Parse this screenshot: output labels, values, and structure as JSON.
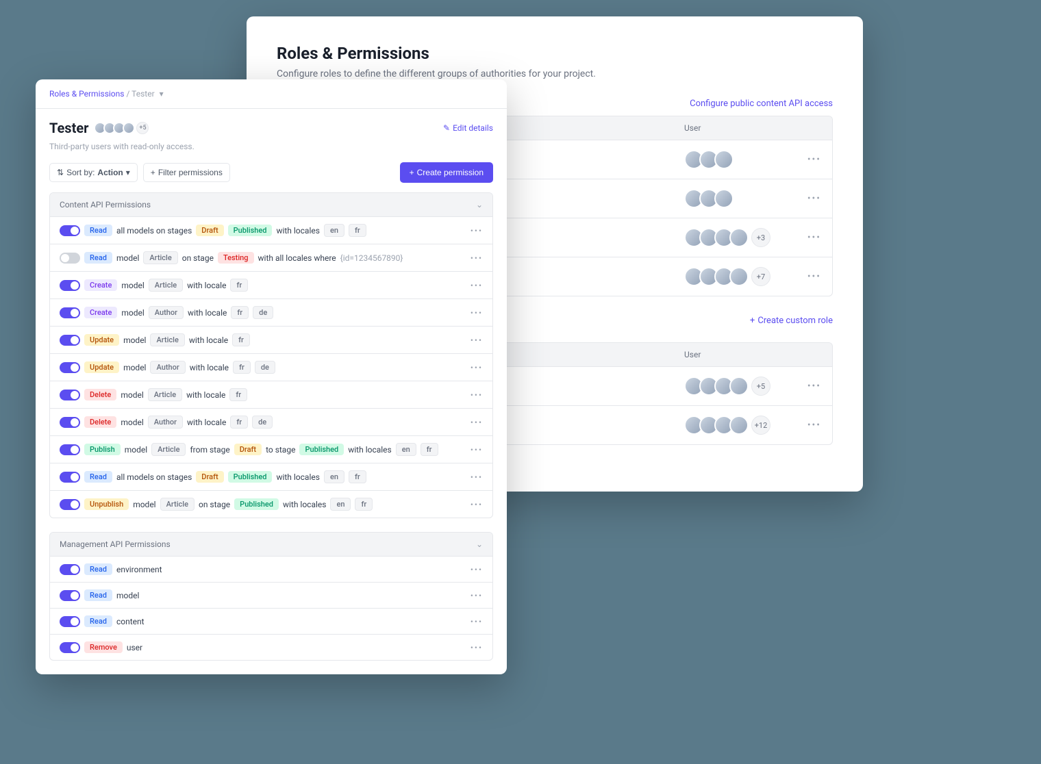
{
  "back": {
    "title": "Roles & Permissions",
    "subtitle": "Configure roles to define the different groups of authorities for your project.",
    "config_link": "Configure public content API access",
    "table1_headers": {
      "user": "User"
    },
    "table1_rows": [
      {
        "avatars": 3,
        "extra": ""
      },
      {
        "avatars": 3,
        "extra": ""
      },
      {
        "avatars": 4,
        "extra": "+3"
      },
      {
        "avatars": 4,
        "extra": "+7"
      }
    ],
    "create_role": "Create custom role",
    "table2_headers": {
      "user": "User"
    },
    "table2_rows": [
      {
        "avatars": 4,
        "extra": "+5"
      },
      {
        "avatars": 4,
        "extra": "+12"
      }
    ]
  },
  "front": {
    "breadcrumb_root": "Roles & Permissions",
    "breadcrumb_current": "Tester",
    "title": "Tester",
    "header_avatar_count": "+5",
    "edit_label": "Edit details",
    "subtitle": "Third-party users with read-only access.",
    "sort_label": "Sort by:",
    "sort_value": "Action",
    "filter_label": "Filter permissions",
    "create_btn": "Create permission",
    "section1_title": "Content API Permissions",
    "section2_title": "Management API Permissions",
    "text": {
      "all_models_on_stages": "all models on stages",
      "with_locales": "with locales",
      "model": "model",
      "on_stage": "on stage",
      "from_stage": "from stage",
      "to_stage": "to stage",
      "with_locale": "with locale",
      "with_all_locales_where": "with all locales where",
      "id_clause": "{id=1234567890}"
    },
    "perms": [
      {
        "on": true,
        "action": "Read",
        "kind": "all",
        "stages": [
          "Draft",
          "Published"
        ],
        "locales": [
          "en",
          "fr"
        ]
      },
      {
        "on": false,
        "action": "Read",
        "kind": "model",
        "model": "Article",
        "stage_single": "Testing",
        "where": true
      },
      {
        "on": true,
        "action": "Create",
        "kind": "model",
        "model": "Article",
        "locale": [
          "fr"
        ]
      },
      {
        "on": true,
        "action": "Create",
        "kind": "model",
        "model": "Author",
        "locale": [
          "fr",
          "de"
        ]
      },
      {
        "on": true,
        "action": "Update",
        "kind": "model",
        "model": "Article",
        "locale": [
          "fr"
        ]
      },
      {
        "on": true,
        "action": "Update",
        "kind": "model",
        "model": "Author",
        "locale": [
          "fr",
          "de"
        ]
      },
      {
        "on": true,
        "action": "Delete",
        "kind": "model",
        "model": "Article",
        "locale": [
          "fr"
        ]
      },
      {
        "on": true,
        "action": "Delete",
        "kind": "model",
        "model": "Author",
        "locale": [
          "fr",
          "de"
        ]
      },
      {
        "on": true,
        "action": "Publish",
        "kind": "model",
        "model": "Article",
        "from_stage": "Draft",
        "to_stage": "Published",
        "locales": [
          "en",
          "fr"
        ]
      },
      {
        "on": true,
        "action": "Read",
        "kind": "all",
        "stages": [
          "Draft",
          "Published"
        ],
        "locales": [
          "en",
          "fr"
        ]
      },
      {
        "on": true,
        "action": "Unpublish",
        "kind": "model",
        "model": "Article",
        "stage_single": "Published",
        "locales": [
          "en",
          "fr"
        ]
      }
    ],
    "mgmt": [
      {
        "on": true,
        "action": "Read",
        "target": "environment"
      },
      {
        "on": true,
        "action": "Read",
        "target": "model"
      },
      {
        "on": true,
        "action": "Read",
        "target": "content"
      },
      {
        "on": true,
        "action": "Remove",
        "target": "user"
      }
    ]
  }
}
